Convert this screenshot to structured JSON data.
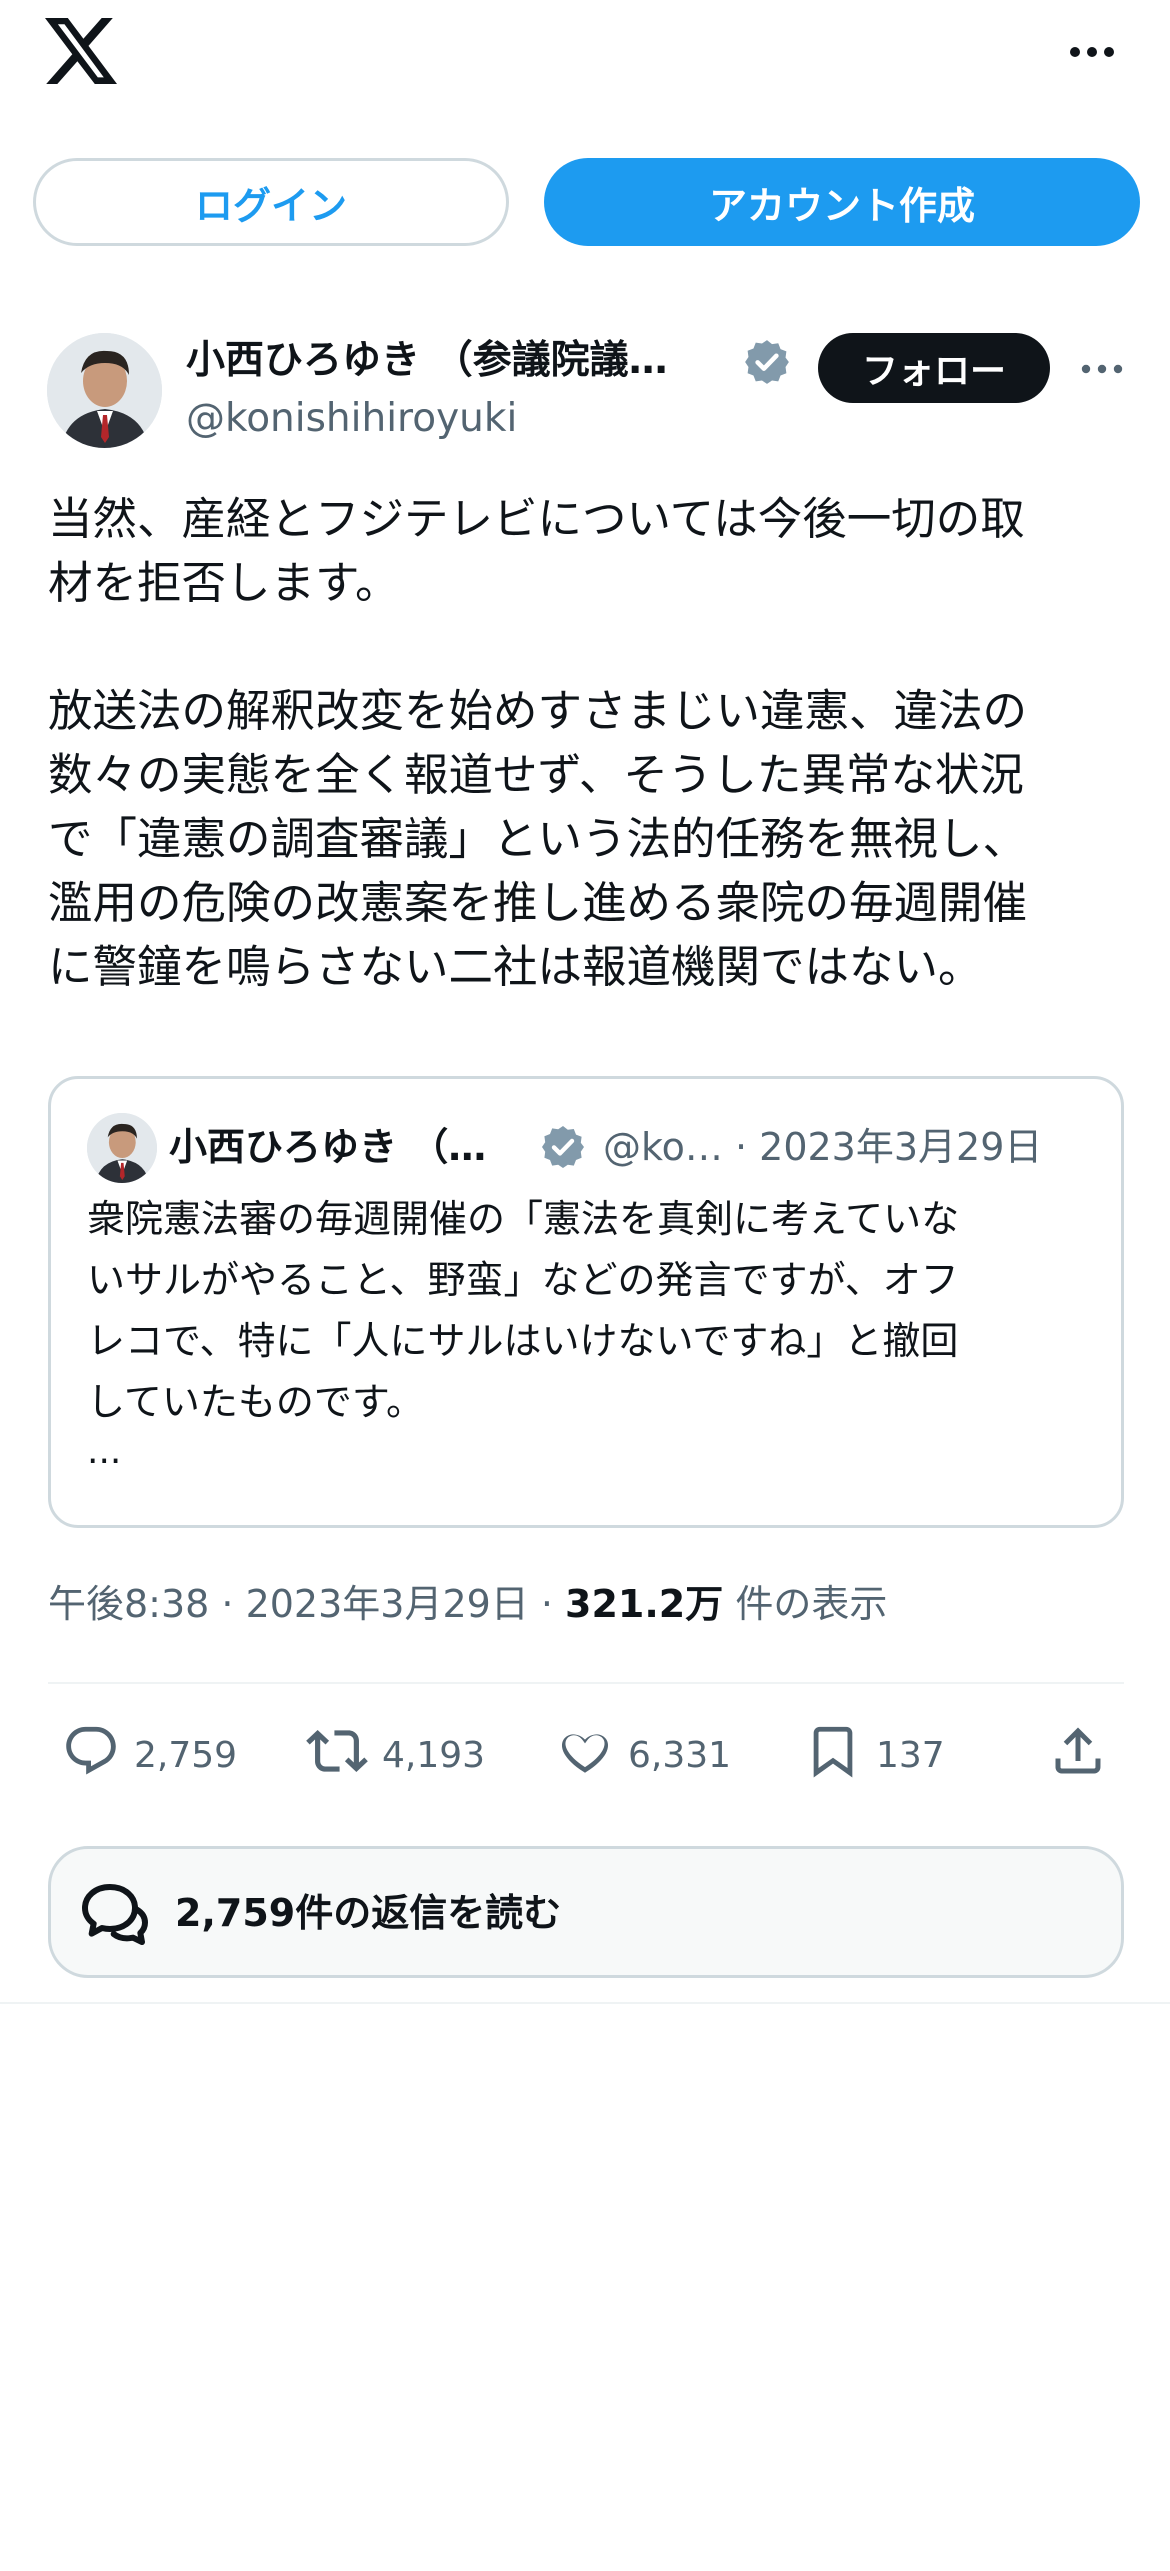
{
  "header": {
    "logo_icon": "x-logo-icon",
    "more_icon": "more-horizontal-icon"
  },
  "auth": {
    "login_label": "ログイン",
    "signup_label": "アカウント作成"
  },
  "author": {
    "name": "小西ひろゆき （参議院議…",
    "handle": "@konishihiroyuki",
    "follow_label": "フォロー"
  },
  "tweet": {
    "text": "当然、産経とフジテレビについては今後一切の取\n材を拒否します。\n\n放送法の解釈改変を始めすさまじい違憲、違法の\n数々の実態を全く報道せず、そうした異常な状況\nで「違憲の調査審議」という法的任務を無視し、\n濫用の危険の改憲案を推し進める衆院の毎週開催\nに警鐘を鳴らさない二社は報道機関ではない。"
  },
  "quote": {
    "name": "小西ひろゆき （…",
    "handle_date": "@ko… · 2023年3月29日",
    "text": "衆院憲法審の毎週開催の「憲法を真剣に考えていな\nいサルがやること、野蛮」などの発言ですが、オフ\nレコで、特に「人にサルはいけないですね」と撤回\nしていたものです。",
    "ellipsis": "..."
  },
  "meta": {
    "time_date": "午後8:38 · 2023年3月29日 · ",
    "views_count": "321.2万",
    "views_label": " 件の表示"
  },
  "actions": {
    "replies": "2,759",
    "reposts": "4,193",
    "likes": "6,331",
    "bookmarks": "137"
  },
  "read_replies": {
    "label": "2,759件の返信を読む"
  },
  "colors": {
    "accent": "#1d9bf0",
    "text": "#0f1419",
    "secondary": "#536471",
    "border": "#cfd9de",
    "verified": "#829aab"
  }
}
